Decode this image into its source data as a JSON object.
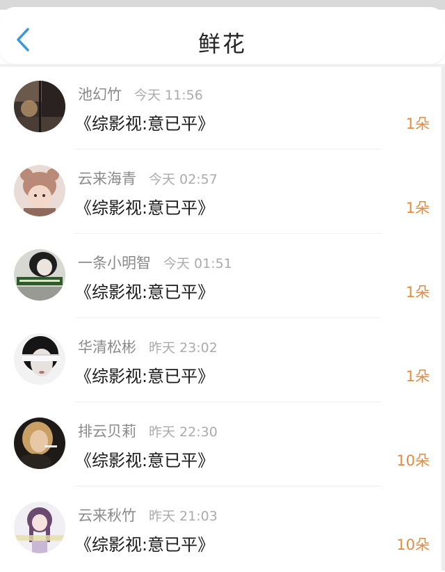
{
  "header": {
    "title": "鲜花",
    "back_icon": "chevron-left-icon",
    "accent_color": "#3a9ad9"
  },
  "colors": {
    "count": "#e58a3e",
    "name": "#8a8a8a",
    "time": "#ababab",
    "work": "#1a1a1a"
  },
  "items": [
    {
      "name": "池幻竹",
      "time": "今天 11:56",
      "work": "《综影视:意已平》",
      "count": "1朵",
      "avatar": "avatar-dusk-window"
    },
    {
      "name": "云来海青",
      "time": "今天 02:57",
      "work": "《综影视:意已平》",
      "count": "1朵",
      "avatar": "avatar-child-hat"
    },
    {
      "name": "一条小明智",
      "time": "今天 01:51",
      "work": "《综影视:意已平》",
      "count": "1朵",
      "avatar": "avatar-girl-banner"
    },
    {
      "name": "华清松彬",
      "time": "昨天 23:02",
      "work": "《综影视:意已平》",
      "count": "1朵",
      "avatar": "avatar-blindfold"
    },
    {
      "name": "排云贝莉",
      "time": "昨天 22:30",
      "work": "《综影视:意已平》",
      "count": "10朵",
      "avatar": "avatar-blonde-smoke"
    },
    {
      "name": "云来秋竹",
      "time": "昨天 21:03",
      "work": "《综影视:意已平》",
      "count": "10朵",
      "avatar": "avatar-anime-girl"
    }
  ]
}
